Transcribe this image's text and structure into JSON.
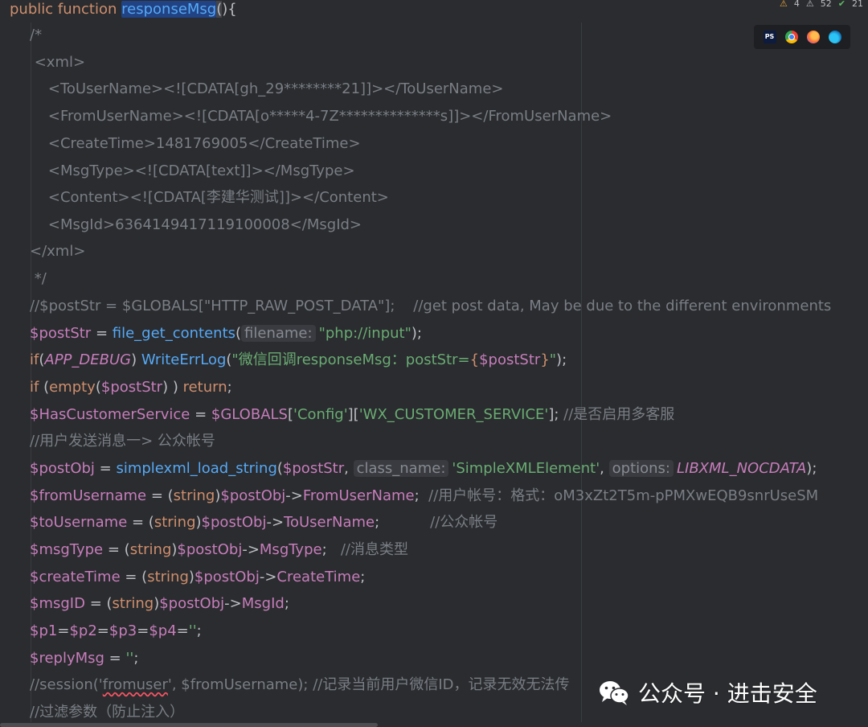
{
  "status_badges": {
    "warnings": "4",
    "weak_warnings": "52",
    "typos": "21"
  },
  "browser_icons": [
    "phpstorm-icon",
    "chrome-icon",
    "firefox-icon",
    "edge-icon"
  ],
  "code": {
    "l1": {
      "kw": "public function ",
      "fn": "responseMsg",
      "p1": "(",
      "p2": "){"
    },
    "l2": "/*",
    "l3": " <xml>",
    "l4": "    <ToUserName><![CDATA[gh_29********21]]></ToUserName>",
    "l5": "    <FromUserName><![CDATA[o*****4-7Z**************s]]></FromUserName>",
    "l6": "    <CreateTime>1481769005</CreateTime>",
    "l7": "    <MsgType><![CDATA[text]]></MsgType>",
    "l8": "    <Content><![CDATA[李建华测试]]></Content>",
    "l9": "    <MsgId>6364149417119100008</MsgId>",
    "l10": "</xml>",
    "l11": " */",
    "l12": "//$postStr = $GLOBALS[\"HTTP_RAW_POST_DATA\"];    //get post data, May be due to the different environments",
    "l13": {
      "var": "$postStr",
      "eq": " = ",
      "fn": "file_get_contents",
      "open": "(",
      "hint": "filename:",
      "str": "\"php://input\"",
      "close": ");"
    },
    "l14": {
      "kw": "if",
      "open": "(",
      "const": "APP_DEBUG",
      "close": ") ",
      "fn": "WriteErrLog",
      "p": "(",
      "str1": "\"微信回调responseMsg：postStr=",
      "b1": "{",
      "sv": "$postStr",
      "b2": "}",
      "str2": "\"",
      "end": ");"
    },
    "l15": {
      "kw": "if",
      "a": " (",
      "fn": "empty",
      "b": "(",
      "var": "$postStr",
      "c": ") ) ",
      "kw2": "return",
      "d": ";"
    },
    "l16": {
      "var": "$HasCustomerService",
      "eq": " = ",
      "var2": "$GLOBALS",
      "a": "[",
      "s1": "'Config'",
      "b": "][",
      "s2": "'WX_CUSTOMER_SERVICE'",
      "c": "];",
      "cm": " //是否启用多客服"
    },
    "l17": "//用户发送消息一> 公众帐号",
    "l18": {
      "var": "$postObj",
      "eq": " = ",
      "fn": "simplexml_load_string",
      "a": "(",
      "var2": "$postStr",
      "comma": ", ",
      "hint1": "class_name:",
      "str": "'SimpleXMLElement'",
      "comma2": ", ",
      "hint2": "options:",
      "const": "LIBXML_NOCDATA",
      "end": ");"
    },
    "l19": {
      "var": "$fromUsername",
      "eq": " = (",
      "kw": "string",
      "a": ")",
      "var2": "$postObj",
      "arrow": "->",
      "prop": "FromUserName",
      "end": ";",
      "cm": "  //用户帐号：格式：oM3xZt2T5m-pPMXwEQB9snrUseSM"
    },
    "l20": {
      "var": "$toUsername",
      "eq": " = (",
      "kw": "string",
      "a": ")",
      "var2": "$postObj",
      "arrow": "->",
      "prop": "ToUserName",
      "end": ";",
      "cm": "           //公众帐号"
    },
    "l21": {
      "var": "$msgType",
      "eq": " = (",
      "kw": "string",
      "a": ")",
      "var2": "$postObj",
      "arrow": "->",
      "prop": "MsgType",
      "end": ";",
      "cm": "   //消息类型"
    },
    "l22": {
      "var": "$createTime",
      "eq": " = (",
      "kw": "string",
      "a": ")",
      "var2": "$postObj",
      "arrow": "->",
      "prop": "CreateTime",
      "end": ";"
    },
    "l23": {
      "var": "$msgID",
      "eq": " = (",
      "kw": "string",
      "a": ")",
      "var2": "$postObj",
      "arrow": "->",
      "prop": "MsgId",
      "end": ";"
    },
    "l24": {
      "v1": "$p1",
      "e1": "=",
      "v2": "$p2",
      "e2": "=",
      "v3": "$p3",
      "e3": "=",
      "v4": "$p4",
      "e4": "=",
      "str": "''",
      "end": ";"
    },
    "l25": {
      "var": "$replyMsg",
      "eq": " = ",
      "str": "''",
      "end": ";"
    },
    "l26": {
      "a": "//session('",
      "b": "fromuser",
      "c": "', $fromUsername); //记录当前用户微信ID，记录无效无法传"
    },
    "l27": "//过滤参数（防止注入）"
  },
  "watermark": {
    "text": "公众号 · 进击安全"
  }
}
